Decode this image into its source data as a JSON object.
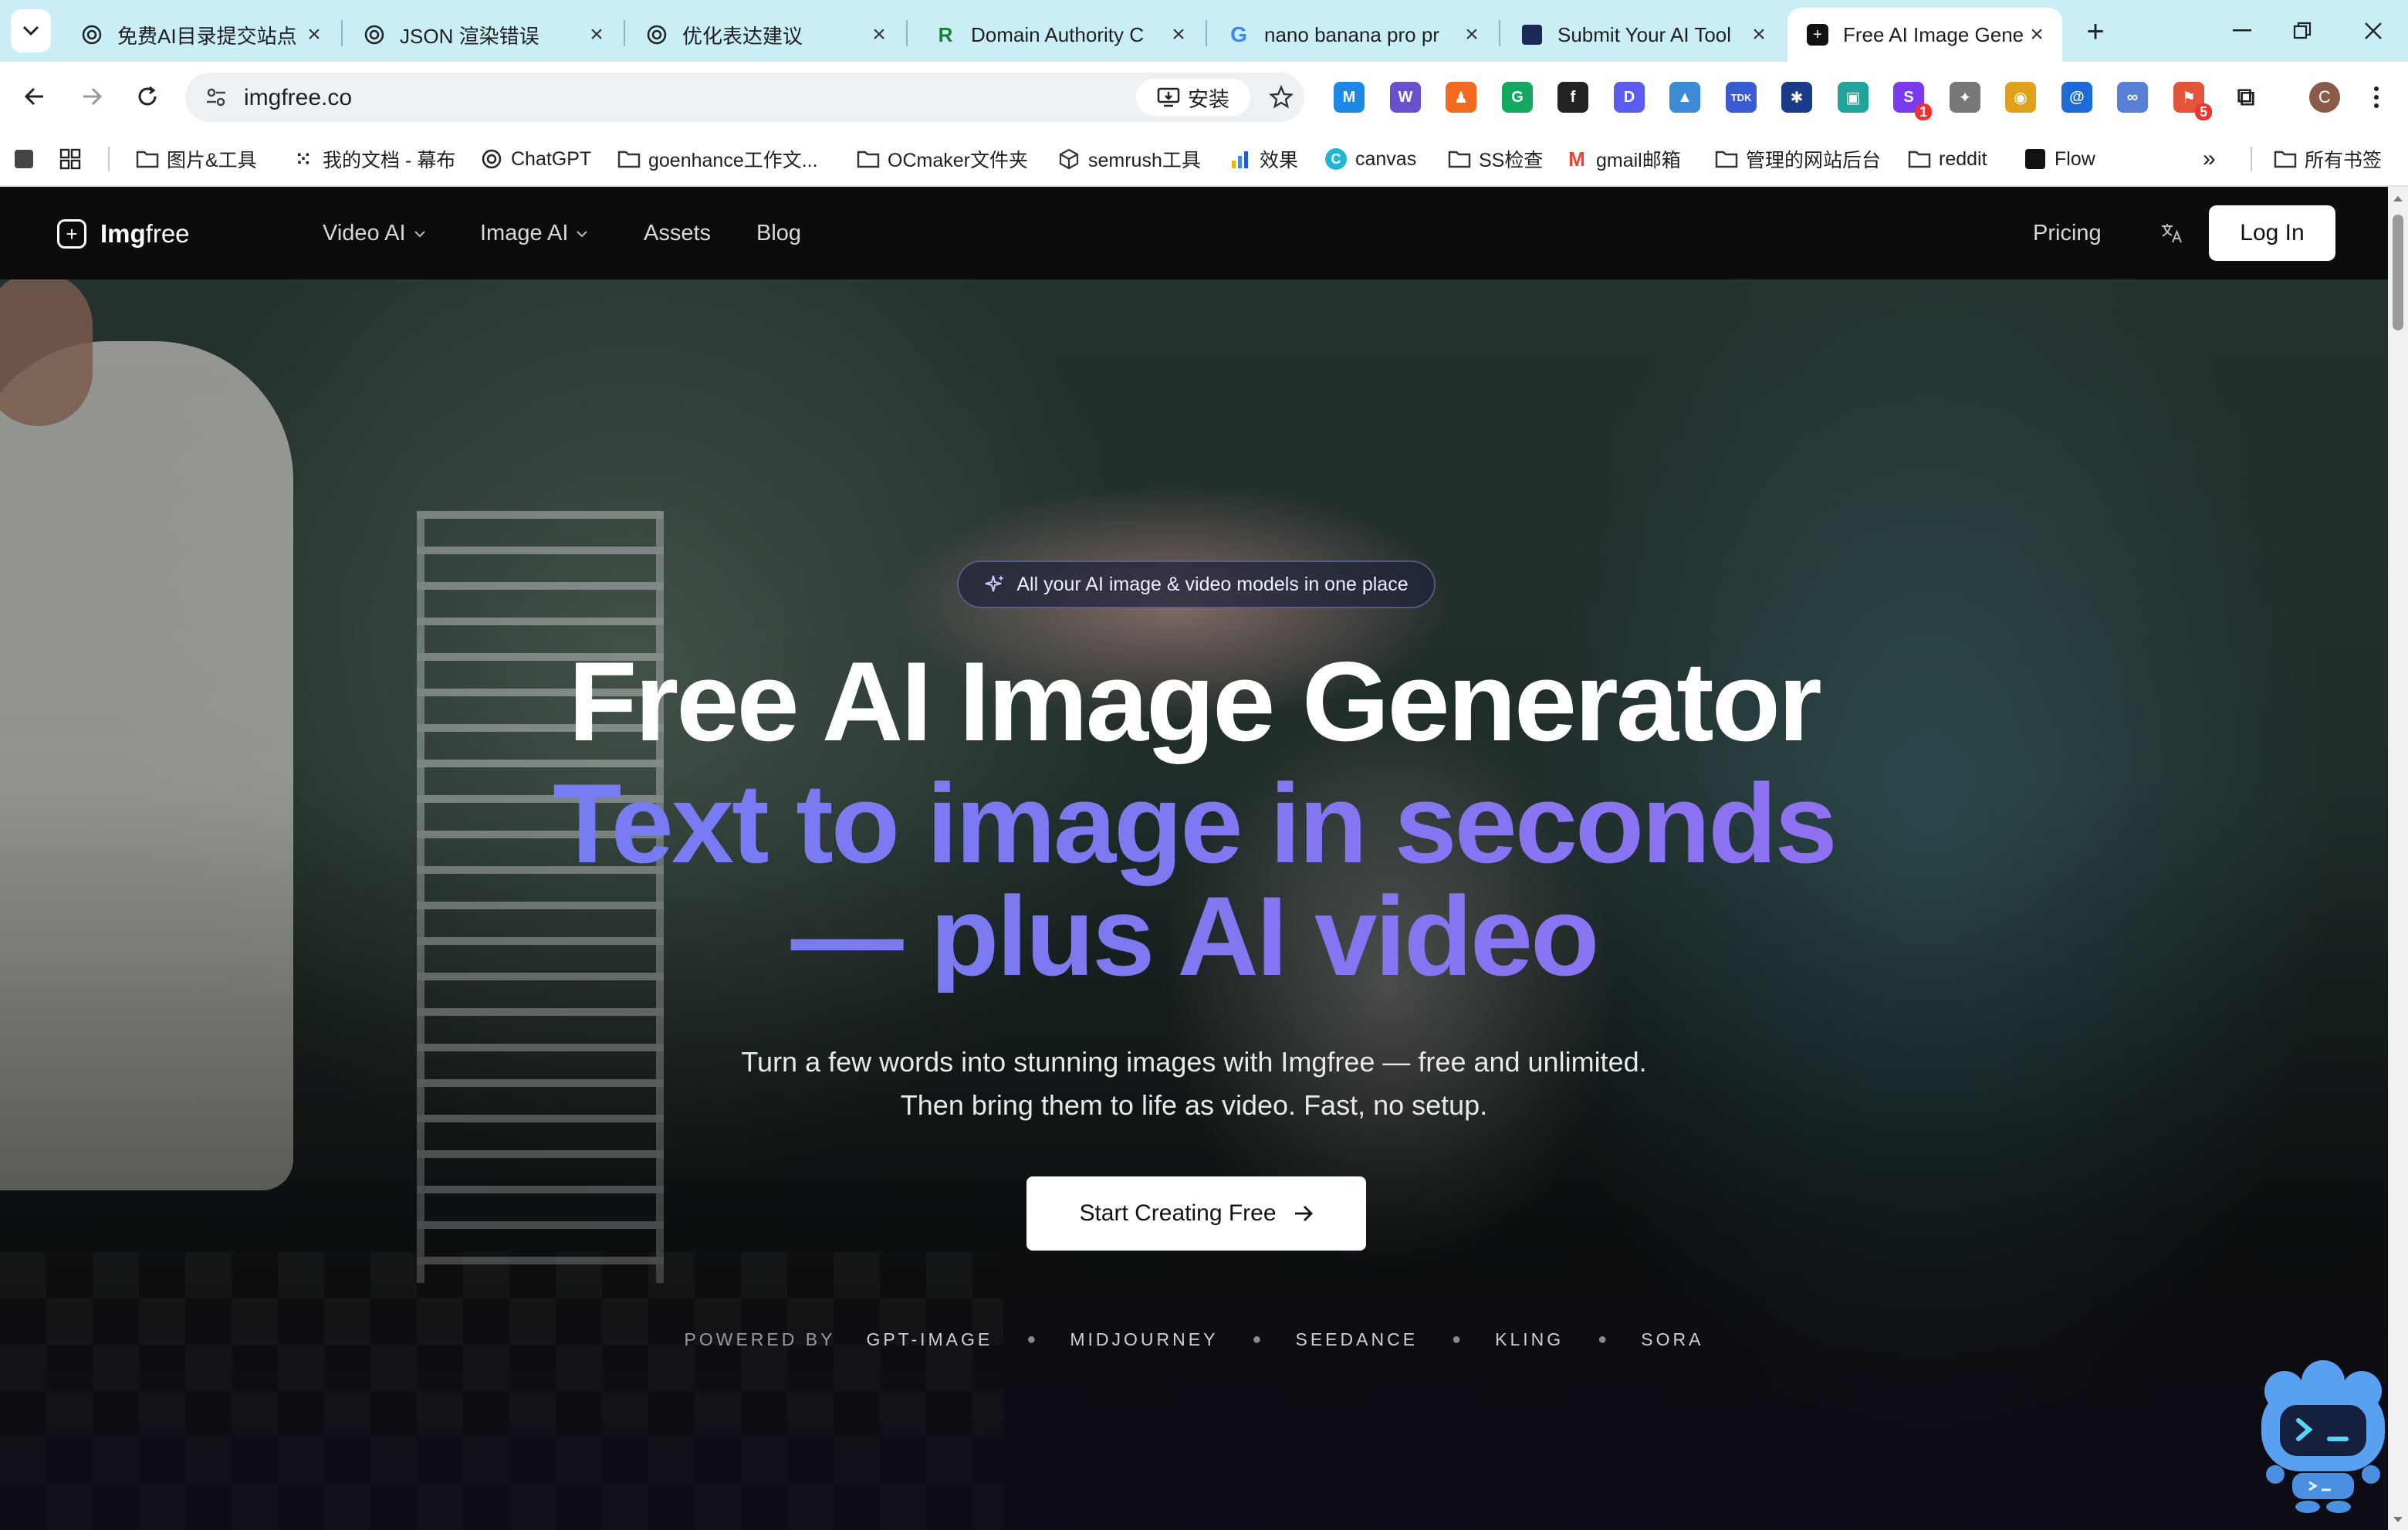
{
  "browser": {
    "tabs": [
      {
        "title": "免费AI目录提交站点",
        "icon": "openai-icon"
      },
      {
        "title": "JSON 渲染错误",
        "icon": "openai-icon"
      },
      {
        "title": "优化表达建议",
        "icon": "openai-icon"
      },
      {
        "title": "Domain Authority C",
        "icon": "r-logo-icon"
      },
      {
        "title": "nano banana pro pr",
        "icon": "google-icon"
      },
      {
        "title": "Submit Your AI Tool",
        "icon": "dark-square-icon"
      },
      {
        "title": "Free AI Image Gene",
        "icon": "imgfree-logo-icon",
        "active": true
      }
    ],
    "url": "imgfree.co",
    "install_label": "安装",
    "profile_initial": "C",
    "extensions": [
      {
        "icon": "m-icon",
        "color": "#1e88e5",
        "glyph": "M"
      },
      {
        "icon": "w-icon",
        "color": "#6a4fcf",
        "glyph": "W"
      },
      {
        "icon": "chess-icon",
        "color": "#f26b21",
        "glyph": "♟"
      },
      {
        "icon": "grammarly-icon",
        "color": "#15a862",
        "glyph": "G"
      },
      {
        "icon": "formula-icon",
        "color": "#222222",
        "glyph": "f"
      },
      {
        "icon": "d-icon",
        "color": "#5a5cf0",
        "glyph": "D"
      },
      {
        "icon": "chart-icon",
        "color": "#3d8bd6",
        "glyph": "▲"
      },
      {
        "icon": "tdk-icon",
        "color": "#3b5bd4",
        "glyph": "TDK"
      },
      {
        "icon": "globe-icon",
        "color": "#1a3b8a",
        "glyph": "✱"
      },
      {
        "icon": "tv-icon",
        "color": "#1fa39b",
        "glyph": "▣"
      },
      {
        "icon": "s-icon",
        "color": "#7c3aed",
        "glyph": "S",
        "badge": "1"
      },
      {
        "icon": "puzzle-piece-icon",
        "color": "#777777",
        "glyph": "✦"
      },
      {
        "icon": "color-wheel-icon",
        "color": "#e0a21c",
        "glyph": "◉"
      },
      {
        "icon": "seo-icon",
        "color": "#1d6bd6",
        "glyph": "@"
      },
      {
        "icon": "link-icon",
        "color": "#5a7fd6",
        "glyph": "∞"
      },
      {
        "icon": "red-ext-icon",
        "color": "#e2553a",
        "glyph": "⚑",
        "badge": "5"
      }
    ],
    "bookmarks": [
      {
        "label": "图片&工具",
        "icon": "folder-icon"
      },
      {
        "label": "我的文档 - 幕布",
        "icon": "mubu-icon"
      },
      {
        "label": "ChatGPT",
        "icon": "openai-icon"
      },
      {
        "label": "goenhance工作文...",
        "icon": "folder-icon"
      },
      {
        "label": "OCmaker文件夹",
        "icon": "folder-icon"
      },
      {
        "label": "semrush工具",
        "icon": "cube-icon"
      },
      {
        "label": "效果",
        "icon": "chart-icon"
      },
      {
        "label": "canvas",
        "icon": "canva-icon"
      },
      {
        "label": "SS检查",
        "icon": "folder-icon"
      },
      {
        "label": "gmail邮箱",
        "icon": "gmail-icon"
      },
      {
        "label": "管理的网站后台",
        "icon": "folder-icon"
      },
      {
        "label": "reddit",
        "icon": "folder-icon"
      },
      {
        "label": "Flow",
        "icon": "flow-icon"
      }
    ],
    "all_bookmarks_label": "所有书签"
  },
  "site": {
    "logo_bold": "Img",
    "logo_light": "free",
    "nav": [
      {
        "label": "Video AI",
        "dropdown": true
      },
      {
        "label": "Image AI",
        "dropdown": true
      },
      {
        "label": "Assets",
        "dropdown": false
      },
      {
        "label": "Blog",
        "dropdown": false
      }
    ],
    "pricing_label": "Pricing",
    "login_label": "Log In"
  },
  "hero": {
    "badge": "All your AI image & video models in one place",
    "headline": "Free AI Image Generator",
    "subhead_line1": "Text to image in seconds",
    "subhead_line2": "— plus AI video",
    "desc_line1": "Turn a few words into stunning images with Imgfree — free and unlimited.",
    "desc_line2": "Then bring them to life as video. Fast, no setup.",
    "cta_label": "Start Creating Free",
    "powered_label": "POWERED BY",
    "models": [
      "GPT-IMAGE",
      "MIDJOURNEY",
      "SEEDANCE",
      "KLING",
      "SORA"
    ]
  },
  "colors": {
    "tabbar": "#c9eef6",
    "gradient_start": "#6d7ff5",
    "gradient_end": "#9a6bf2",
    "nav_bg": "#0c0c0d"
  }
}
